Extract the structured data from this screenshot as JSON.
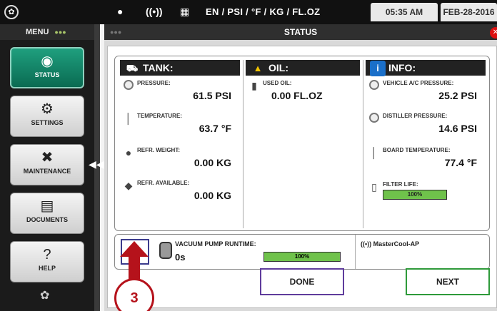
{
  "topbar": {
    "units": "EN / PSI / °F / KG / FL.OZ",
    "time": "05:35 AM",
    "date": "FEB-28-2016"
  },
  "sidebar": {
    "title": "MENU",
    "items": [
      {
        "label": "STATUS",
        "icon": "status-icon",
        "active": true
      },
      {
        "label": "SETTINGS",
        "icon": "gear-icon",
        "active": false
      },
      {
        "label": "MAINTENANCE",
        "icon": "tools-icon",
        "active": false
      },
      {
        "label": "DOCUMENTS",
        "icon": "document-icon",
        "active": false
      },
      {
        "label": "HELP",
        "icon": "help-icon",
        "active": false
      }
    ]
  },
  "window": {
    "title": "STATUS"
  },
  "tank": {
    "header": "TANK:",
    "pressure_label": "PRESSURE:",
    "pressure_value": "61.5 PSI",
    "temperature_label": "TEMPERATURE:",
    "temperature_value": "63.7 °F",
    "refr_weight_label": "REFR. WEIGHT:",
    "refr_weight_value": "0.00 KG",
    "refr_available_label": "REFR. AVAILABLE:",
    "refr_available_value": "0.00 KG"
  },
  "oil": {
    "header": "OIL:",
    "used_oil_label": "USED OIL:",
    "used_oil_value": "0.00 FL.OZ"
  },
  "info": {
    "header": "INFO:",
    "ac_pressure_label": "VEHICLE A/C PRESSURE:",
    "ac_pressure_value": "25.2 PSI",
    "distiller_label": "DISTILLER PRESSURE:",
    "distiller_value": "14.6 PSI",
    "board_temp_label": "BOARD TEMPERATURE:",
    "board_temp_value": "77.4 °F",
    "filter_label": "FILTER LIFE:",
    "filter_value": "100%",
    "filter_fraction": 1.0
  },
  "runtime": {
    "label": "VACUUM PUMP RUNTIME:",
    "value": "0s",
    "percent_text": "100%",
    "fraction": 1.0
  },
  "network": {
    "name": "MasterCool-AP"
  },
  "buttons": {
    "done": "DONE",
    "next": "NEXT"
  },
  "annotation": {
    "step": "3",
    "color": "#b5121b"
  },
  "colors": {
    "accent_green": "#6fc24b",
    "active_menu": "#0a6b52",
    "done_border": "#5f3c9c",
    "next_border": "#2e9a3a"
  }
}
